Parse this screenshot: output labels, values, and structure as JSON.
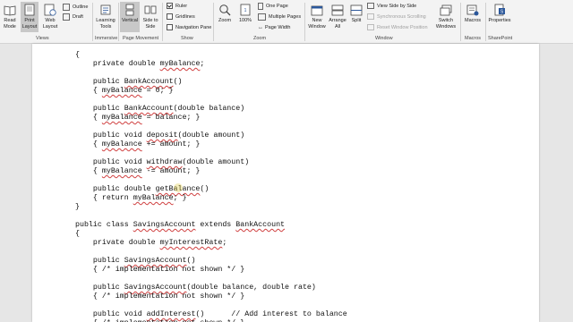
{
  "ribbon": {
    "views": {
      "label": "Views",
      "read_mode": "Read Mode",
      "print_layout": "Print Layout",
      "web_layout": "Web Layout",
      "outline": "Outline",
      "draft": "Draft"
    },
    "immersive": {
      "label": "Immersive",
      "learning_tools": "Learning Tools"
    },
    "page_movement": {
      "label": "Page Movement",
      "vertical": "Vertical",
      "side_to_side": "Side to Side"
    },
    "show": {
      "label": "Show",
      "ruler": "Ruler",
      "gridlines": "Gridlines",
      "navigation_pane": "Navigation Pane"
    },
    "zoom": {
      "label": "Zoom",
      "zoom": "Zoom",
      "percent": "100%",
      "one_page": "One Page",
      "multiple_pages": "Multiple Pages",
      "page_width": "Page Width"
    },
    "window": {
      "label": "Window",
      "new_window": "New Window",
      "arrange_all": "Arrange All",
      "split": "Split",
      "view_side_by_side": "View Side by Side",
      "sync_scrolling": "Synchronous Scrolling",
      "reset_window": "Reset Window Position",
      "switch_windows": "Switch Windows"
    },
    "macros": {
      "label": "Macros",
      "macros": "Macros"
    },
    "sharepoint": {
      "label": "SharePoint",
      "properties": "Properties"
    }
  },
  "document": {
    "lines": [
      [
        {
          "t": "{"
        }
      ],
      [
        {
          "t": "    private double "
        },
        {
          "t": "myBalance",
          "sq": true
        },
        {
          "t": ";"
        }
      ],
      [],
      [
        {
          "t": "    public "
        },
        {
          "t": "BankAccount",
          "sq": true
        },
        {
          "t": "()"
        }
      ],
      [
        {
          "t": "    { "
        },
        {
          "t": "myBalance",
          "sq": true
        },
        {
          "t": " = 0; }"
        }
      ],
      [],
      [
        {
          "t": "    public "
        },
        {
          "t": "BankAccount",
          "sq": true
        },
        {
          "t": "(double balance)"
        }
      ],
      [
        {
          "t": "    { "
        },
        {
          "t": "myBalance",
          "sq": true
        },
        {
          "t": " = balance; }"
        }
      ],
      [],
      [
        {
          "t": "    public void "
        },
        {
          "t": "deposit",
          "sq": true
        },
        {
          "t": "(double amount)"
        }
      ],
      [
        {
          "t": "    { "
        },
        {
          "t": "myBalance",
          "sq": true
        },
        {
          "t": " += amount; }"
        }
      ],
      [],
      [
        {
          "t": "    public void "
        },
        {
          "t": "withdraw",
          "sq": true
        },
        {
          "t": "(double amount)"
        }
      ],
      [
        {
          "t": "    { "
        },
        {
          "t": "myBalance",
          "sq": true
        },
        {
          "t": " -= amount; }"
        }
      ],
      [],
      [
        {
          "t": "    public double "
        },
        {
          "t": "getBalance",
          "sq": true
        },
        {
          "t": "()"
        }
      ],
      [
        {
          "t": "    { return "
        },
        {
          "t": "myBalance",
          "sq": true
        },
        {
          "t": "; }"
        }
      ],
      [
        {
          "t": "}"
        }
      ],
      [],
      [
        {
          "t": "public class "
        },
        {
          "t": "SavingsAccount",
          "sq": true
        },
        {
          "t": " extends "
        },
        {
          "t": "BankAccount",
          "sq": true
        }
      ],
      [
        {
          "t": "{"
        }
      ],
      [
        {
          "t": "    private double "
        },
        {
          "t": "myInterestRate",
          "sq": true
        },
        {
          "t": ";"
        }
      ],
      [],
      [
        {
          "t": "    public "
        },
        {
          "t": "SavingsAccount",
          "sq": true
        },
        {
          "t": "()"
        }
      ],
      [
        {
          "t": "    { /* implementation not shown */ }"
        }
      ],
      [],
      [
        {
          "t": "    public "
        },
        {
          "t": "SavingsAccount",
          "sq": true
        },
        {
          "t": "(double balance, double rate)"
        }
      ],
      [
        {
          "t": "    { /* implementation not shown */ }"
        }
      ],
      [],
      [
        {
          "t": "    public void "
        },
        {
          "t": "addInterest",
          "sq": true
        },
        {
          "t": "()      // Add interest to balance"
        }
      ],
      [
        {
          "t": "    { /* implementation not shown */ }"
        }
      ]
    ]
  }
}
